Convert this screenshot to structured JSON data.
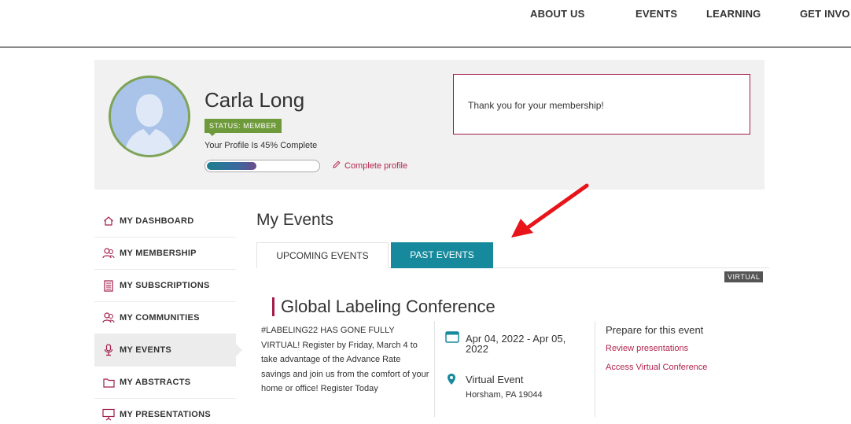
{
  "topnav": {
    "items": [
      "ABOUT US",
      "EVENTS",
      "LEARNING",
      "GET INVO"
    ]
  },
  "profile": {
    "name": "Carla Long",
    "status": "STATUS: MEMBER",
    "completion_text": "Your Profile Is 45% Complete",
    "completion_percent": 45,
    "complete_link": "Complete profile",
    "message": "Thank you for your membership!"
  },
  "sidebar": {
    "items": [
      {
        "label": "MY DASHBOARD",
        "icon": "home-icon"
      },
      {
        "label": "MY MEMBERSHIP",
        "icon": "member-icon"
      },
      {
        "label": "MY SUBSCRIPTIONS",
        "icon": "document-icon"
      },
      {
        "label": "MY COMMUNITIES",
        "icon": "community-icon"
      },
      {
        "label": "MY EVENTS",
        "icon": "microphone-icon",
        "active": true
      },
      {
        "label": "MY ABSTRACTS",
        "icon": "folder-icon"
      },
      {
        "label": "MY PRESENTATIONS",
        "icon": "presentation-icon"
      }
    ]
  },
  "main": {
    "title": "My Events",
    "tabs": [
      {
        "label": "UPCOMING EVENTS",
        "selected": false
      },
      {
        "label": "PAST EVENTS",
        "selected": true
      }
    ],
    "event": {
      "badge": "VIRTUAL",
      "title": "Global Labeling Conference",
      "description": "#LABELING22 HAS GONE FULLY VIRTUAL! Register by Friday, March 4 to take advantage of the Advance Rate savings and join us from the comfort of your home or office! Register Today",
      "date": "Apr 04, 2022 - Apr 05, 2022",
      "location_name": "Virtual Event",
      "location_address": "Horsham, PA 19044",
      "prepare_title": "Prepare for this event",
      "links": [
        "Review presentations",
        "Access Virtual Conference"
      ]
    }
  },
  "colors": {
    "accent_teal": "#16899c",
    "accent_crimson": "#a21c48",
    "status_green": "#6f9a3b",
    "annotation_red": "#e8141a"
  }
}
